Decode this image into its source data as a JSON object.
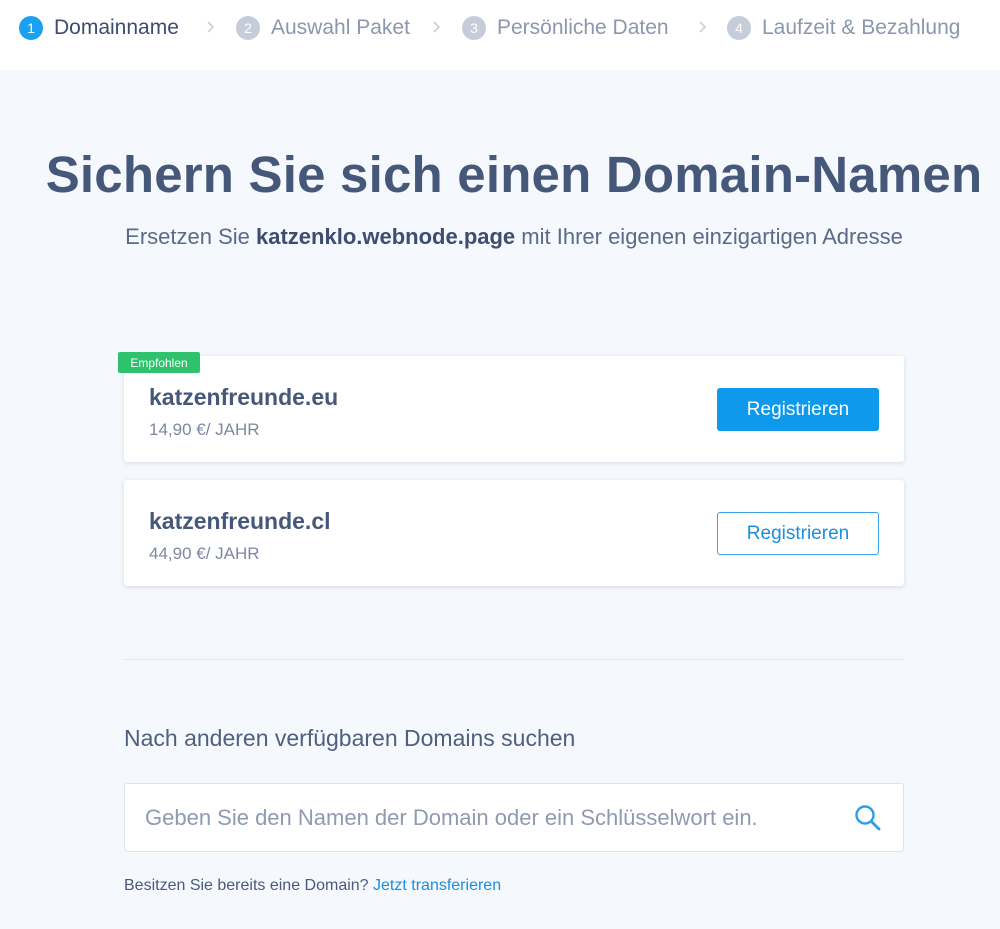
{
  "stepper": {
    "steps": [
      {
        "number": "1",
        "label": "Domainname"
      },
      {
        "number": "2",
        "label": "Auswahl Paket"
      },
      {
        "number": "3",
        "label": "Persönliche Daten"
      },
      {
        "number": "4",
        "label": "Laufzeit & Bezahlung"
      }
    ],
    "active_step": 1,
    "separator_icon": "chevron-right-icon"
  },
  "hero": {
    "title": "Sichern Sie sich einen Domain-Namen",
    "subtitle_prefix": "Ersetzen Sie ",
    "current_domain": "katzenklo.webnode.page",
    "subtitle_suffix": " mit Ihrer eigenen einzigartigen Adresse"
  },
  "offers": [
    {
      "badge": "Empfohlen",
      "domain": "katzenfreunde.eu",
      "price": "14,90 €/ JAHR",
      "button_label": "Registrieren",
      "button_style": "primary"
    },
    {
      "domain": "katzenfreunde.cl",
      "price": "44,90 €/ JAHR",
      "button_label": "Registrieren",
      "button_style": "outline"
    }
  ],
  "search": {
    "heading": "Nach anderen verfügbaren Domains suchen",
    "placeholder": "Geben Sie den Namen der Domain oder ein Schlüsselwort ein.",
    "value": "",
    "icon": "search-icon"
  },
  "transfer": {
    "text": "Besitzen Sie bereits eine Domain? ",
    "link_label": "Jetzt transferieren"
  },
  "colors": {
    "page_background": "#f5f8fd",
    "accent": "#0e99ec",
    "badge": "#2dc26b",
    "heading": "#465879",
    "inactive_step": "#c5cdda"
  }
}
